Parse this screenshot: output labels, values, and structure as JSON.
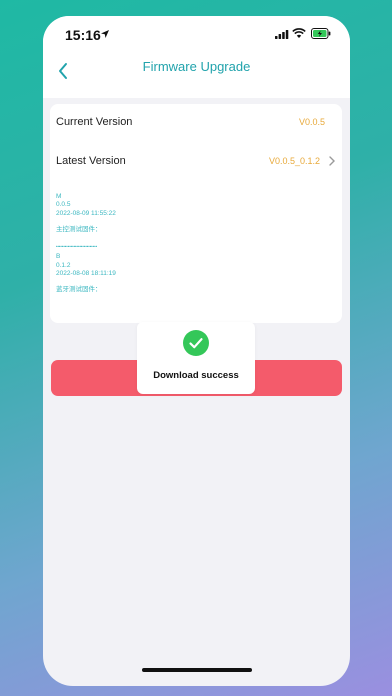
{
  "status_bar": {
    "time": "15:16",
    "icons": [
      "location-arrow-icon",
      "cellular-signal-icon",
      "wifi-icon",
      "battery-charging-icon"
    ]
  },
  "nav": {
    "title": "Firmware Upgrade",
    "back_icon": "chevron-left-icon"
  },
  "versions": {
    "current_label": "Current Version",
    "current_value": "V0.0.5",
    "latest_label": "Latest Version",
    "latest_value": "V0.0.5_0.1.2"
  },
  "log": {
    "m_code": "M",
    "m_version": "0.0.5",
    "m_date": "2022-08-09 11:55:22",
    "m_desc": "主控测试固件：",
    "separator": "••••••••••••••••••••••••••••",
    "b_code": "B",
    "b_version": "0.1.2",
    "b_date": "2022-08-08 18:11:19",
    "b_desc": "蓝牙测试固件："
  },
  "toast": {
    "icon": "check-circle-icon",
    "message": "Download success"
  },
  "colors": {
    "accent": "#21a3ac",
    "version_value": "#e8a93a",
    "log_text": "#3ab7c0",
    "button": "#f45b6b",
    "success": "#34c759"
  }
}
